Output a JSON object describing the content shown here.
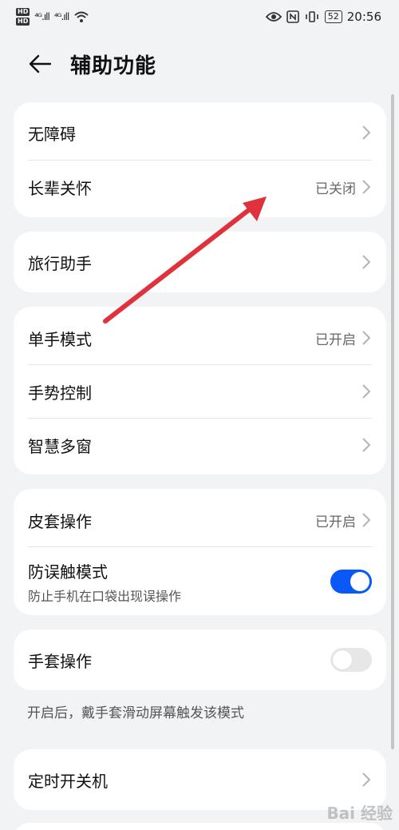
{
  "status": {
    "hd1": "HD",
    "hd2": "HD",
    "sig1": "⁴ᴳ.ıll",
    "sig2": "⁴ᴳ.ıll",
    "battery": "52",
    "time": "20:56"
  },
  "header": {
    "title": "辅助功能"
  },
  "groups": {
    "g1": {
      "r1": {
        "label": "无障碍"
      },
      "r2": {
        "label": "长辈关怀",
        "value": "已关闭"
      }
    },
    "g2": {
      "r1": {
        "label": "旅行助手"
      }
    },
    "g3": {
      "r1": {
        "label": "单手模式",
        "value": "已开启"
      },
      "r2": {
        "label": "手势控制"
      },
      "r3": {
        "label": "智慧多窗"
      }
    },
    "g4": {
      "r1": {
        "label": "皮套操作",
        "value": "已开启"
      },
      "r2": {
        "label": "防误触模式",
        "sub": "防止手机在口袋出现误操作",
        "toggle_on": true
      }
    },
    "g5": {
      "r1": {
        "label": "手套操作",
        "toggle_on": false
      },
      "note": "开启后，戴手套滑动屏幕触发该模式"
    },
    "g6": {
      "r1": {
        "label": "定时开关机"
      }
    }
  },
  "watermark": "Bai 经验",
  "colors": {
    "accent": "#0a59f7",
    "arrow": "#e0323c",
    "background": "#f1f3f5"
  }
}
